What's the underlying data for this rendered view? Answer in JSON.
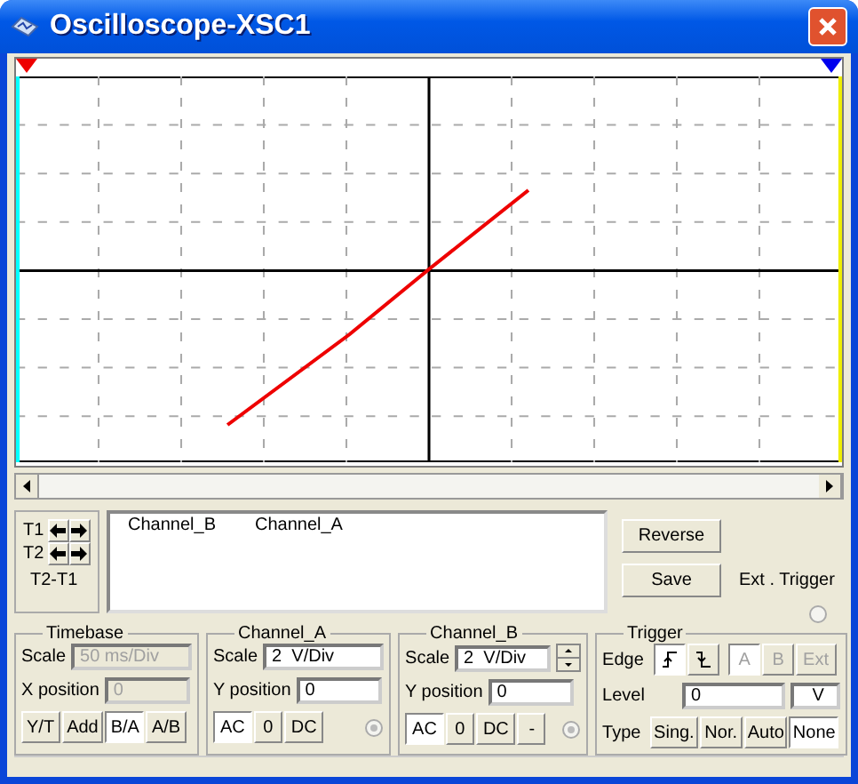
{
  "window": {
    "title": "Oscilloscope-XSC1"
  },
  "cursors": {
    "t1_label": "T1",
    "t2_label": "T2",
    "diff_label": "T2-T1"
  },
  "readout": {
    "columns": [
      "Channel_B",
      "Channel_A"
    ]
  },
  "buttons": [
    {
      "label": "Reverse"
    },
    {
      "label": "Save"
    }
  ],
  "ext_trigger": {
    "label": "Ext . Trigger"
  },
  "timebase": {
    "title": "Timebase",
    "scale_label": "Scale",
    "scale": "50 ms/Div",
    "xpos_label": "X position",
    "xpos": "0",
    "disabled": true,
    "modes": [
      {
        "label": "Y/T",
        "selected": false
      },
      {
        "label": "Add",
        "selected": false
      },
      {
        "label": "B/A",
        "selected": true
      },
      {
        "label": "A/B",
        "selected": false
      }
    ]
  },
  "channel_a": {
    "title": "Channel_A",
    "scale_label": "Scale",
    "scale": "2  V/Div",
    "ypos_label": "Y position",
    "ypos": "0",
    "coupling": [
      {
        "label": "AC",
        "selected": true
      },
      {
        "label": "0",
        "selected": false
      },
      {
        "label": "DC",
        "selected": false
      }
    ]
  },
  "channel_b": {
    "title": "Channel_B",
    "scale_label": "Scale",
    "scale": "2  V/Div",
    "ypos_label": "Y position",
    "ypos": "0",
    "coupling": [
      {
        "label": "AC",
        "selected": true
      },
      {
        "label": "0",
        "selected": false
      },
      {
        "label": "DC",
        "selected": false
      },
      {
        "label": "-",
        "selected": false
      }
    ]
  },
  "trigger": {
    "title": "Trigger",
    "edge_label": "Edge",
    "level_label": "Level",
    "level": "0",
    "unit": "V",
    "type_label": "Type",
    "edges": [
      {
        "kind": "rising",
        "selected": true
      },
      {
        "kind": "falling",
        "selected": false
      }
    ],
    "sources": [
      {
        "label": "A",
        "selected": true,
        "disabled": true
      },
      {
        "label": "B",
        "selected": false,
        "disabled": true
      },
      {
        "label": "Ext",
        "selected": false,
        "disabled": true
      }
    ],
    "types": [
      {
        "label": "Sing.",
        "selected": false
      },
      {
        "label": "Nor.",
        "selected": false
      },
      {
        "label": "Auto",
        "selected": false
      },
      {
        "label": "None",
        "selected": true
      }
    ]
  }
}
